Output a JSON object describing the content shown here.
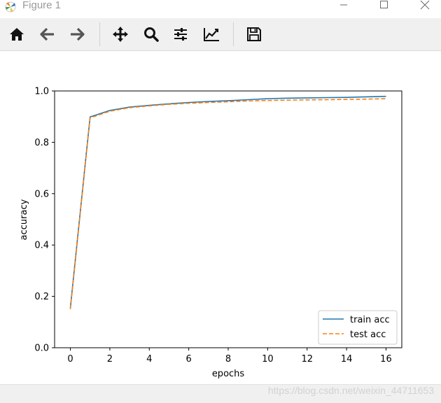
{
  "window": {
    "title": "Figure 1",
    "app_icon": "matplotlib-icon",
    "controls": [
      "minimize-icon",
      "maximize-icon",
      "close-icon"
    ]
  },
  "toolbar": {
    "buttons": [
      {
        "name": "home-button",
        "icon": "home-icon"
      },
      {
        "name": "back-button",
        "icon": "arrow-left-icon"
      },
      {
        "name": "forward-button",
        "icon": "arrow-right-icon"
      },
      {
        "name": "pan-button",
        "icon": "move-arrows-icon"
      },
      {
        "name": "zoom-button",
        "icon": "magnifier-icon"
      },
      {
        "name": "configure-subplots-button",
        "icon": "sliders-icon"
      },
      {
        "name": "edit-axis-button",
        "icon": "line-chart-icon"
      },
      {
        "name": "save-button",
        "icon": "floppy-disk-icon"
      }
    ]
  },
  "chart_data": {
    "type": "line",
    "title": "",
    "xlabel": "epochs",
    "ylabel": "accuracy",
    "xlim": [
      -0.8,
      16.8
    ],
    "ylim": [
      0.0,
      1.0
    ],
    "xticks": [
      "0",
      "2",
      "4",
      "6",
      "8",
      "10",
      "12",
      "14",
      "16"
    ],
    "yticks": [
      "0.0",
      "0.2",
      "0.4",
      "0.6",
      "0.8",
      "1.0"
    ],
    "grid": false,
    "legend_position": "lower-right",
    "x": [
      0,
      1,
      2,
      3,
      4,
      5,
      6,
      7,
      8,
      9,
      10,
      11,
      12,
      13,
      14,
      15,
      16
    ],
    "series": [
      {
        "name": "train acc",
        "color": "#1f77b4",
        "style": "solid",
        "values": [
          0.155,
          0.899,
          0.924,
          0.937,
          0.944,
          0.95,
          0.955,
          0.959,
          0.962,
          0.966,
          0.97,
          0.972,
          0.973,
          0.974,
          0.975,
          0.977,
          0.979
        ]
      },
      {
        "name": "test acc",
        "color": "#ff7f0e",
        "style": "dashed",
        "values": [
          0.15,
          0.895,
          0.921,
          0.935,
          0.942,
          0.948,
          0.952,
          0.955,
          0.958,
          0.961,
          0.963,
          0.964,
          0.965,
          0.966,
          0.967,
          0.968,
          0.97
        ]
      }
    ]
  },
  "statusbar": {
    "watermark": "https://blog.csdn.net/weixin_44711653"
  }
}
